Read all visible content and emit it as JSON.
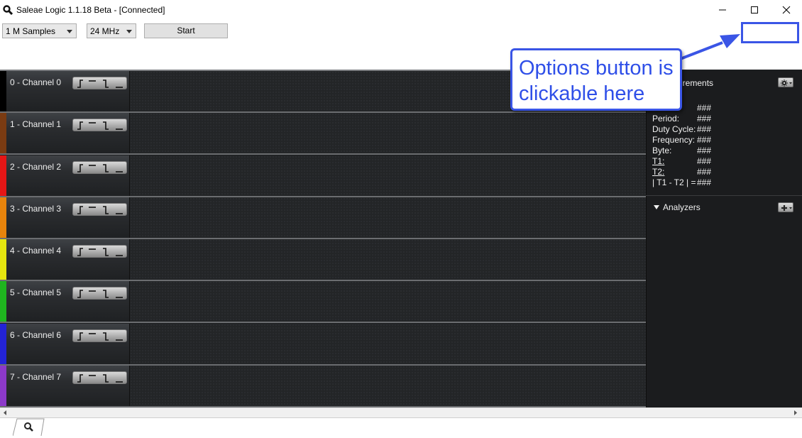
{
  "window": {
    "title": "Saleae Logic 1.1.18 Beta - [Connected]",
    "controls": [
      "minimize",
      "maximize",
      "close"
    ]
  },
  "toolbar": {
    "samples_value": "1 M Samples",
    "rate_value": "24 MHz",
    "start_label": "Start"
  },
  "channels": [
    {
      "label": "0 - Channel 0",
      "color": "#000000"
    },
    {
      "label": "1 - Channel 1",
      "color": "#7a3b12"
    },
    {
      "label": "2 - Channel 2",
      "color": "#e51616"
    },
    {
      "label": "3 - Channel 3",
      "color": "#e8840c"
    },
    {
      "label": "4 - Channel 4",
      "color": "#e6e60f"
    },
    {
      "label": "5 - Channel 5",
      "color": "#1fb51f"
    },
    {
      "label": "6 - Channel 6",
      "color": "#2323d6"
    },
    {
      "label": "7 - Channel 7",
      "color": "#8c39c9"
    }
  ],
  "measurements": {
    "title_visible": "urements",
    "rows": [
      {
        "label": "",
        "value": "###"
      },
      {
        "label": "Period:",
        "value": "###"
      },
      {
        "label": "Duty Cycle:",
        "value": "###"
      },
      {
        "label": "Frequency:",
        "value": "###"
      },
      {
        "label": "Byte:",
        "value": "###"
      },
      {
        "label": "T1:",
        "value": "###"
      },
      {
        "label": "T2:",
        "value": "###"
      },
      {
        "label": "| T1 - T2 | =",
        "value": "###"
      }
    ]
  },
  "analyzers": {
    "title": "Analyzers"
  },
  "annotation": {
    "text": "Options button is clickable here",
    "color": "#3a55e6"
  }
}
